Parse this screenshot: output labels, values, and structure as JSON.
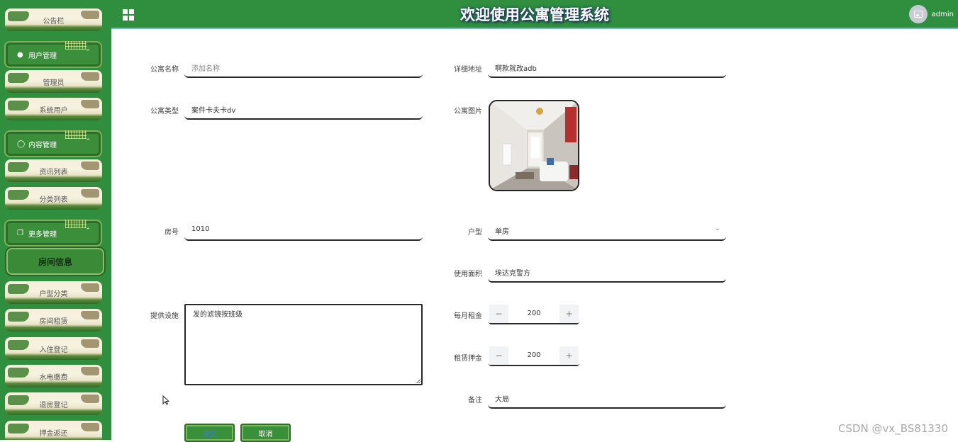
{
  "header": {
    "title": "欢迎使用公寓管理系统",
    "username": "admin"
  },
  "sidebar": {
    "top_item": "公告栏",
    "groups": [
      {
        "label": "用户管理",
        "items": [
          "管理员",
          "系统用户"
        ]
      },
      {
        "label": "内容管理",
        "items": [
          "资讯列表",
          "分类列表"
        ]
      },
      {
        "label": "更多管理",
        "items": [
          "房间信息",
          "户型分类",
          "房间租赁",
          "入住登记",
          "水电缴费",
          "退房登记",
          "押金返还"
        ]
      }
    ],
    "active": "房间信息"
  },
  "form": {
    "name_label": "公寓名称",
    "name_placeholder": "添加名称",
    "address_label": "详细地址",
    "address_value": "啊款就改adb",
    "type_label": "公寓类型",
    "type_value": "案件卡夫卡dv",
    "image_label": "公寓图片",
    "room_label": "房号",
    "room_value": "1010",
    "layout_label": "户型",
    "layout_value": "单房",
    "area_label": "使用面积",
    "area_value": "埃达克警方",
    "facility_label": "提供设施",
    "facility_value": "发的滤镜按班级",
    "rent_label": "每月租金",
    "rent_value": "200",
    "deposit_label": "租赁押金",
    "deposit_value": "200",
    "remark_label": "备注",
    "remark_value": "大局",
    "submit": "提交",
    "cancel": "取消"
  },
  "watermark": "CSDN @vx_BS81330"
}
